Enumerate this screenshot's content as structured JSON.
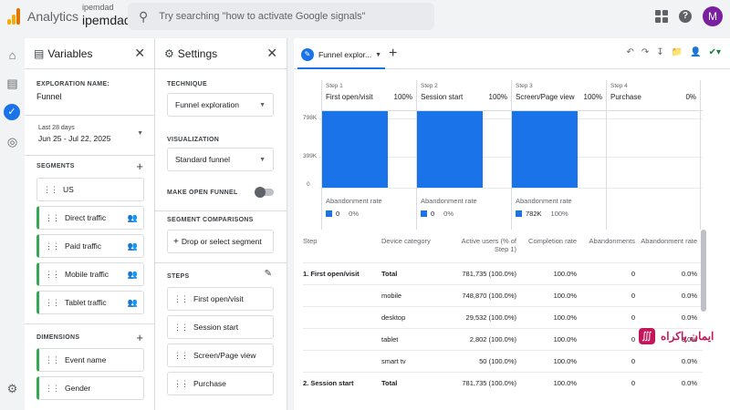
{
  "topbar": {
    "app_name": "Analytics",
    "account_small": "ipemdad",
    "account_name": "ipemdad",
    "search_placeholder": "Try searching \"how to activate Google signals\"",
    "avatar_letter": "M"
  },
  "variables": {
    "title": "Variables",
    "exploration_name_label": "EXPLORATION NAME:",
    "exploration_name": "Funnel",
    "date_range_label": "Last 28 days",
    "date_range": "Jun 25 - Jul 22, 2025",
    "segments_label": "SEGMENTS",
    "segments": [
      "US",
      "Direct traffic",
      "Paid traffic",
      "Mobile traffic",
      "Tablet traffic"
    ],
    "dimensions_label": "DIMENSIONS",
    "dimensions": [
      "Event name",
      "Gender"
    ]
  },
  "settings": {
    "title": "Settings",
    "technique_label": "TECHNIQUE",
    "technique": "Funnel exploration",
    "visualization_label": "VISUALIZATION",
    "visualization": "Standard funnel",
    "make_open_funnel_label": "MAKE OPEN FUNNEL",
    "segment_comparisons_label": "SEGMENT COMPARISONS",
    "segment_drop": "Drop or select segment",
    "steps_label": "STEPS",
    "steps": [
      "First open/visit",
      "Session start",
      "Screen/Page view",
      "Purchase"
    ]
  },
  "canvas": {
    "tab_label": "Funnel explor...",
    "y_ticks": [
      "798K",
      "399K",
      "0"
    ],
    "steps": [
      {
        "num": "Step 1",
        "name": "First open/visit",
        "pct": "100%",
        "ab_label": "Abandonment rate",
        "ab_value": "0",
        "ab_pct": "0%",
        "fill": 1.0
      },
      {
        "num": "Step 2",
        "name": "Session start",
        "pct": "100%",
        "ab_label": "Abandonment rate",
        "ab_value": "0",
        "ab_pct": "0%",
        "fill": 1.0
      },
      {
        "num": "Step 3",
        "name": "Screen/Page view",
        "pct": "100%",
        "ab_label": "Abandonment rate",
        "ab_value": "782K",
        "ab_pct": "100%",
        "fill": 1.0
      },
      {
        "num": "Step 4",
        "name": "Purchase",
        "pct": "0%",
        "ab_label": "",
        "ab_value": "",
        "ab_pct": "",
        "fill": 0.0
      }
    ],
    "table": {
      "headers": [
        "Step",
        "Device category",
        "Active users (% of Step 1)",
        "Completion rate",
        "Abandonments",
        "Abandonment rate"
      ],
      "rows": [
        {
          "step": "1. First open/visit",
          "device": "Total",
          "users": "781,735 (100.0%)",
          "completion": "100.0%",
          "abandon": "0",
          "abrate": "0.0%",
          "bold": true
        },
        {
          "step": "",
          "device": "mobile",
          "users": "748,870 (100.0%)",
          "completion": "100.0%",
          "abandon": "0",
          "abrate": "0.0%",
          "bold": false
        },
        {
          "step": "",
          "device": "desktop",
          "users": "29,532 (100.0%)",
          "completion": "100.0%",
          "abandon": "0",
          "abrate": "0.0%",
          "bold": false
        },
        {
          "step": "",
          "device": "tablet",
          "users": "2,802 (100.0%)",
          "completion": "100.0%",
          "abandon": "0",
          "abrate": "0.0%",
          "bold": false
        },
        {
          "step": "",
          "device": "smart tv",
          "users": "50 (100.0%)",
          "completion": "100.0%",
          "abandon": "0",
          "abrate": "0.0%",
          "bold": false
        },
        {
          "step": "2. Session start",
          "device": "Total",
          "users": "781,735 (100.0%)",
          "completion": "100.0%",
          "abandon": "0",
          "abrate": "0.0%",
          "bold": true
        }
      ]
    }
  },
  "watermark": {
    "text": "ایمان پاکراه"
  },
  "colors": {
    "accent": "#1a73e8",
    "segment_green": "#34a853",
    "avatar": "#7b1fa2",
    "watermark": "#c2185b"
  }
}
